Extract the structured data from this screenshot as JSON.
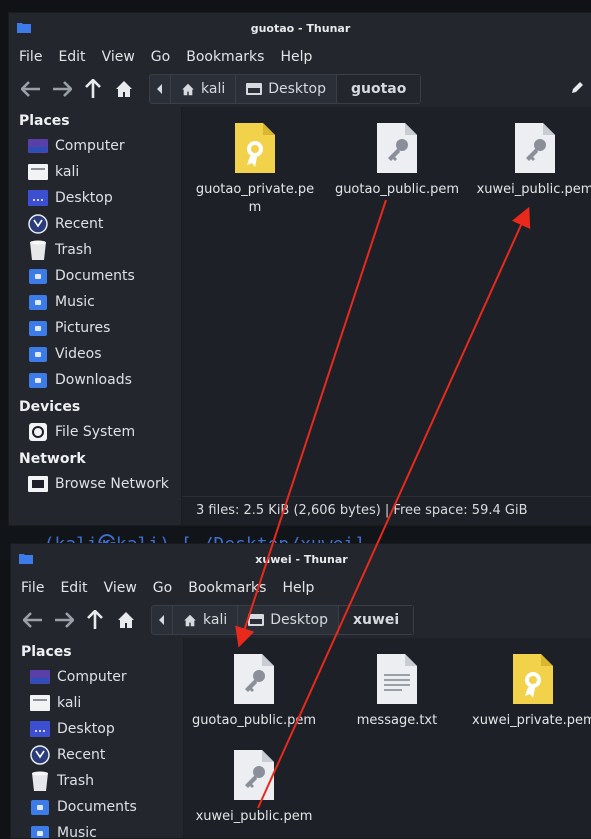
{
  "terminal": {
    "text": "──(kali㉿kali)-[~/Desktop/xuwei]"
  },
  "win1": {
    "title": "guotao - Thunar",
    "menu": [
      "File",
      "Edit",
      "View",
      "Go",
      "Bookmarks",
      "Help"
    ],
    "crumbs": {
      "home": "kali",
      "desktop": "Desktop",
      "current": "guotao"
    },
    "places_label": "Places",
    "places": [
      "Computer",
      "kali",
      "Desktop",
      "Recent",
      "Trash",
      "Documents",
      "Music",
      "Pictures",
      "Videos",
      "Downloads"
    ],
    "devices_label": "Devices",
    "devices": [
      "File System"
    ],
    "network_label": "Network",
    "network": [
      "Browse Network"
    ],
    "files": [
      {
        "name": "guotao_private.pe\nm",
        "kind": "private-key"
      },
      {
        "name": "guotao_public.pem",
        "kind": "public-key"
      },
      {
        "name": "xuwei_public.pem",
        "kind": "public-key"
      }
    ],
    "status": "3 files: 2.5 KiB (2,606 bytes)  |  Free space: 59.4 GiB"
  },
  "win2": {
    "title": "xuwei - Thunar",
    "menu": [
      "File",
      "Edit",
      "View",
      "Go",
      "Bookmarks",
      "Help"
    ],
    "crumbs": {
      "home": "kali",
      "desktop": "Desktop",
      "current": "xuwei"
    },
    "places_label": "Places",
    "places": [
      "Computer",
      "kali",
      "Desktop",
      "Recent",
      "Trash",
      "Documents",
      "Music"
    ],
    "files": [
      {
        "name": "guotao_public.pem",
        "kind": "public-key"
      },
      {
        "name": "message.txt",
        "kind": "text"
      },
      {
        "name": "xuwei_private.pem",
        "kind": "private-key"
      },
      {
        "name": "xuwei_public.pem",
        "kind": "public-key"
      }
    ]
  },
  "colors": {
    "accent": "#3c7be8",
    "arrow": "#e8291c",
    "window_bg": "#23262d",
    "view_bg": "#1d2026"
  }
}
